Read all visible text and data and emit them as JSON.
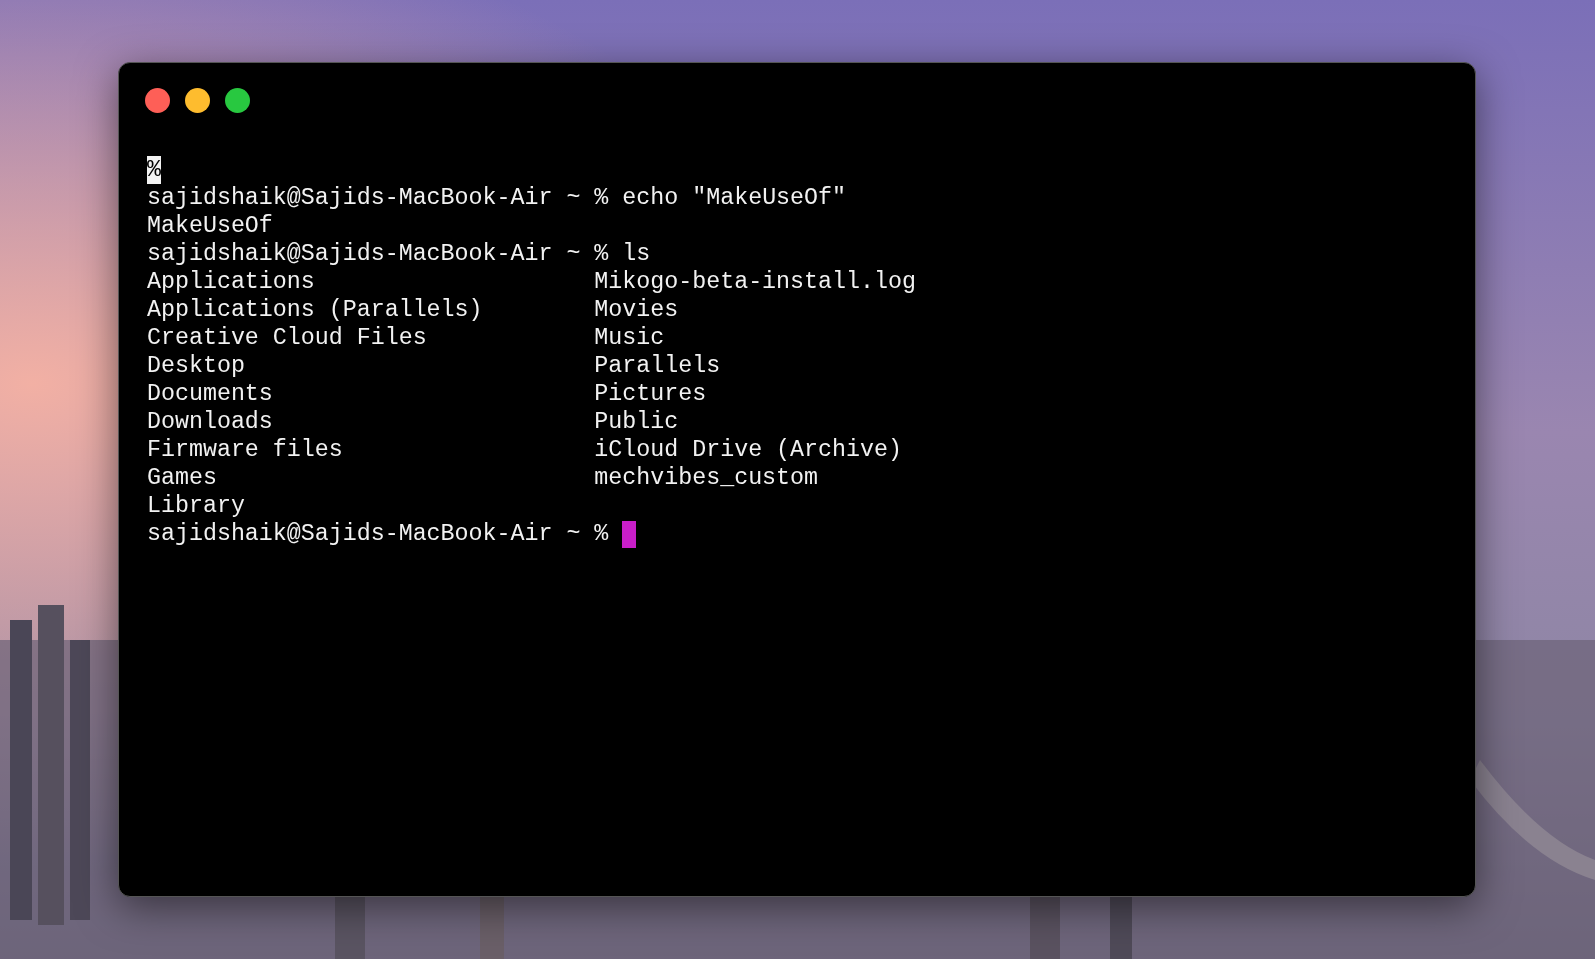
{
  "window": {
    "controls": [
      {
        "color": "#fe5f57"
      },
      {
        "color": "#febc2e"
      },
      {
        "color": "#28c840"
      }
    ]
  },
  "terminal": {
    "lines": [
      {
        "kind": "marker",
        "text": "%"
      },
      {
        "kind": "text",
        "text": "sajidshaik@Sajids-MacBook-Air ~ % echo \"MakeUseOf\""
      },
      {
        "kind": "text",
        "text": "MakeUseOf"
      },
      {
        "kind": "text",
        "text": "sajidshaik@Sajids-MacBook-Air ~ % ls"
      },
      {
        "kind": "columns",
        "columns": [
          "Applications",
          "Mikogo-beta-install.log"
        ]
      },
      {
        "kind": "columns",
        "columns": [
          "Applications (Parallels)",
          "Movies"
        ]
      },
      {
        "kind": "columns",
        "columns": [
          "Creative Cloud Files",
          "Music"
        ]
      },
      {
        "kind": "columns",
        "columns": [
          "Desktop",
          "Parallels"
        ]
      },
      {
        "kind": "columns",
        "columns": [
          "Documents",
          "Pictures"
        ]
      },
      {
        "kind": "columns",
        "columns": [
          "Downloads",
          "Public"
        ]
      },
      {
        "kind": "columns",
        "columns": [
          "Firmware files",
          "iCloud Drive (Archive)"
        ]
      },
      {
        "kind": "columns",
        "columns": [
          "Games",
          "mechvibes_custom"
        ]
      },
      {
        "kind": "columns",
        "columns": [
          "Library"
        ]
      },
      {
        "kind": "prompt",
        "text": "sajidshaik@Sajids-MacBook-Air ~ %",
        "cursor": true
      }
    ]
  }
}
